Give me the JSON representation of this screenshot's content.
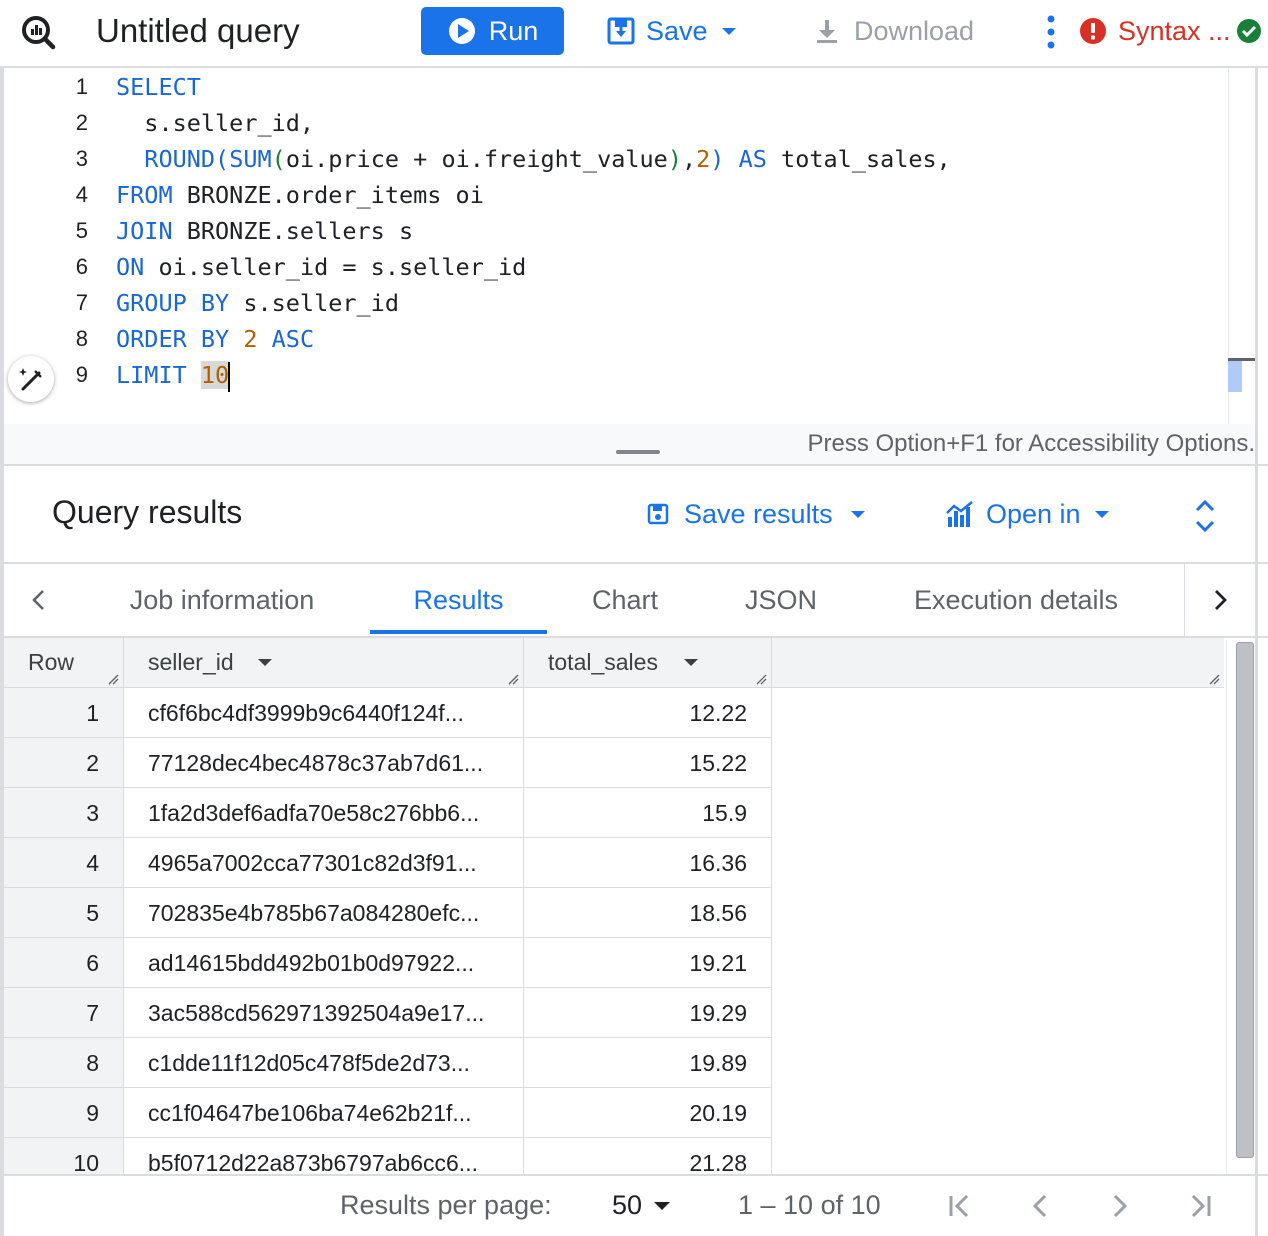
{
  "toolbar": {
    "title": "Untitled query",
    "run_label": "Run",
    "save_label": "Save",
    "download_label": "Download",
    "syntax_label": "Syntax ..."
  },
  "editor": {
    "line_numbers": [
      "1",
      "2",
      "3",
      "4",
      "5",
      "6",
      "7",
      "8",
      "9"
    ],
    "accessibility_hint": "Press Option+F1 for Accessibility Options."
  },
  "results": {
    "title": "Query results",
    "save_results_label": "Save results",
    "open_in_label": "Open in"
  },
  "tabs": [
    {
      "label": "Job information"
    },
    {
      "label": "Results"
    },
    {
      "label": "Chart"
    },
    {
      "label": "JSON"
    },
    {
      "label": "Execution details"
    }
  ],
  "table": {
    "columns": [
      "Row",
      "seller_id",
      "total_sales"
    ],
    "rows": [
      {
        "row": "1",
        "seller_id": "cf6f6bc4df3999b9c6440f124f...",
        "total_sales": "12.22"
      },
      {
        "row": "2",
        "seller_id": "77128dec4bec4878c37ab7d61...",
        "total_sales": "15.22"
      },
      {
        "row": "3",
        "seller_id": "1fa2d3def6adfa70e58c276bb6...",
        "total_sales": "15.9"
      },
      {
        "row": "4",
        "seller_id": "4965a7002cca77301c82d3f91...",
        "total_sales": "16.36"
      },
      {
        "row": "5",
        "seller_id": "702835e4b785b67a084280efc...",
        "total_sales": "18.56"
      },
      {
        "row": "6",
        "seller_id": "ad14615bdd492b01b0d97922...",
        "total_sales": "19.21"
      },
      {
        "row": "7",
        "seller_id": "3ac588cd562971392504a9e17...",
        "total_sales": "19.29"
      },
      {
        "row": "8",
        "seller_id": "c1dde11f12d05c478f5de2d73...",
        "total_sales": "19.89"
      },
      {
        "row": "9",
        "seller_id": "cc1f04647be106ba74e62b21f...",
        "total_sales": "20.19"
      },
      {
        "row": "10",
        "seller_id": "b5f0712d22a873b6797ab6cc6...",
        "total_sales": "21.28"
      }
    ]
  },
  "pager": {
    "per_page_label": "Results per page:",
    "per_page_value": "50",
    "range": "1 – 10 of 10"
  },
  "colors": {
    "accent": "#1a73e8",
    "error": "#d93025",
    "success": "#188038"
  },
  "icons": [
    "bigquery-logo-icon",
    "play-icon",
    "save-icon",
    "download-icon",
    "more-vert-icon",
    "error-icon",
    "check-circle-icon",
    "ai-assist-icon",
    "save-results-icon",
    "chart-icon",
    "expand-icon",
    "chevron-left-icon",
    "chevron-right-icon",
    "first-page-icon",
    "last-page-icon"
  ]
}
